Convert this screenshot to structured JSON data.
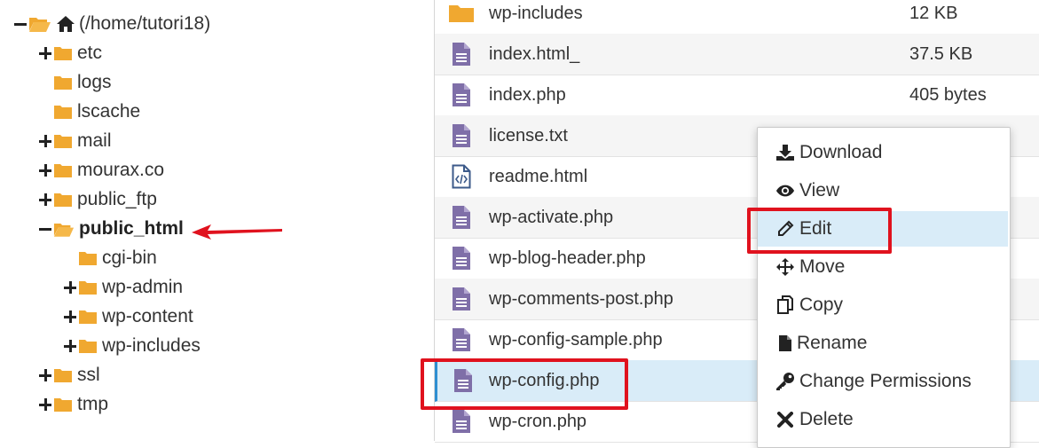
{
  "tree": {
    "root": "(/home/tutori18)",
    "items": [
      {
        "label": "etc",
        "toggle": "plus"
      },
      {
        "label": "logs",
        "toggle": "none"
      },
      {
        "label": "lscache",
        "toggle": "none"
      },
      {
        "label": "mail",
        "toggle": "plus"
      },
      {
        "label": "mourax.co",
        "toggle": "plus"
      },
      {
        "label": "public_ftp",
        "toggle": "plus"
      },
      {
        "label": "public_html",
        "toggle": "minus"
      },
      {
        "label": "cgi-bin",
        "toggle": "none"
      },
      {
        "label": "wp-admin",
        "toggle": "plus"
      },
      {
        "label": "wp-content",
        "toggle": "plus"
      },
      {
        "label": "wp-includes",
        "toggle": "plus"
      },
      {
        "label": "ssl",
        "toggle": "plus"
      },
      {
        "label": "tmp",
        "toggle": "plus"
      }
    ]
  },
  "files": [
    {
      "name": "wp-includes",
      "size": "12 KB",
      "icon": "folder-icon"
    },
    {
      "name": "index.html_",
      "size": "37.5 KB",
      "icon": "file-icon"
    },
    {
      "name": "index.php",
      "size": "405 bytes",
      "icon": "file-icon"
    },
    {
      "name": "license.txt",
      "size": "",
      "icon": "file-icon"
    },
    {
      "name": "readme.html",
      "size": "",
      "icon": "code-file-icon"
    },
    {
      "name": "wp-activate.php",
      "size": "",
      "icon": "file-icon"
    },
    {
      "name": "wp-blog-header.php",
      "size": "",
      "icon": "file-icon"
    },
    {
      "name": "wp-comments-post.php",
      "size": "",
      "icon": "file-icon"
    },
    {
      "name": "wp-config-sample.php",
      "size": "",
      "icon": "file-icon"
    },
    {
      "name": "wp-config.php",
      "size": "",
      "icon": "file-icon"
    },
    {
      "name": "wp-cron.php",
      "size": "",
      "icon": "file-icon"
    }
  ],
  "context_menu": {
    "items": [
      {
        "label": "Download",
        "icon": "download-icon"
      },
      {
        "label": "View",
        "icon": "eye-icon"
      },
      {
        "label": "Edit",
        "icon": "pencil-icon"
      },
      {
        "label": "Move",
        "icon": "move-icon"
      },
      {
        "label": "Copy",
        "icon": "copy-icon"
      },
      {
        "label": "Rename",
        "icon": "rename-icon"
      },
      {
        "label": "Change Permissions",
        "icon": "key-icon"
      },
      {
        "label": "Delete",
        "icon": "delete-icon"
      }
    ]
  },
  "colors": {
    "folder": "#f0a830",
    "file": "#7f6fa8",
    "highlight": "#e0121e",
    "selected_row": "#d9ecf8"
  }
}
